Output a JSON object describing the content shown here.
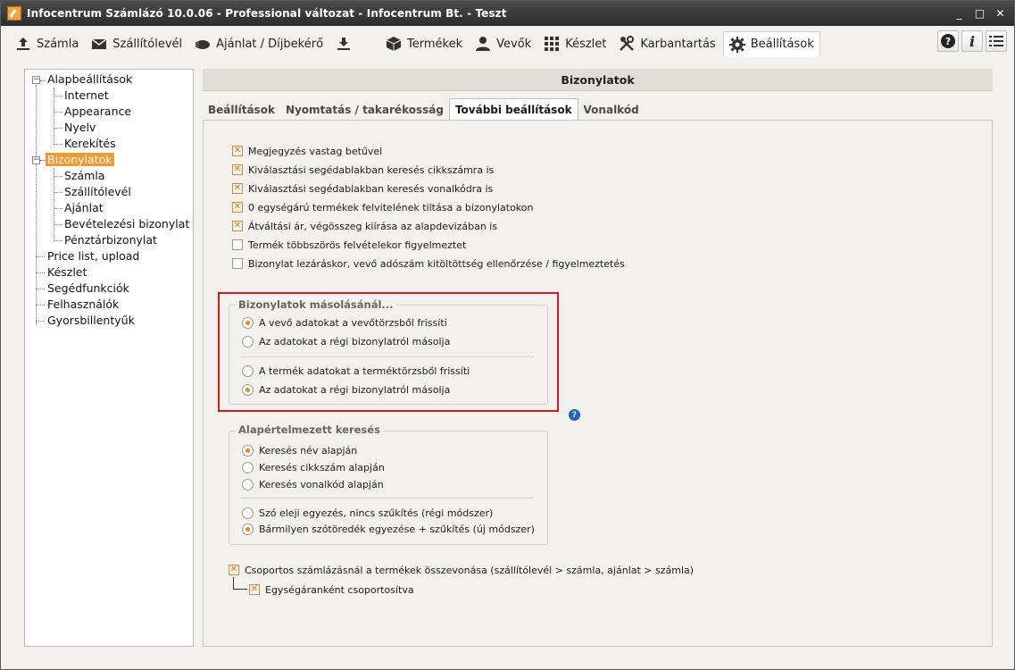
{
  "window": {
    "title": "Infocentrum Számlázó 10.0.06 - Professional változat - Infocentrum Bt. - Teszt",
    "controls": [
      "_",
      "□",
      "✕"
    ]
  },
  "toolbar": {
    "items": [
      {
        "label": "Számla",
        "icon": "upload-icon"
      },
      {
        "label": "Szállítólevél",
        "icon": "envelope-icon"
      },
      {
        "label": "Ajánlat / Díjbekérő",
        "icon": "handshake-icon"
      },
      {
        "label": "",
        "icon": "download-icon"
      },
      {
        "label": "Termékek",
        "icon": "box-icon"
      },
      {
        "label": "Vevők",
        "icon": "person-icon"
      },
      {
        "label": "Készlet",
        "icon": "grid-icon"
      },
      {
        "label": "Karbantartás",
        "icon": "tools-icon"
      },
      {
        "label": "Beállítások",
        "icon": "gear-icon"
      }
    ],
    "right_buttons": [
      "help-icon",
      "info-icon",
      "list-icon"
    ]
  },
  "tree": {
    "root1": "Alapbeállítások",
    "root1_children": [
      "Internet",
      "Appearance",
      "Nyelv",
      "Kerekítés"
    ],
    "root2": "Bizonylatok",
    "root2_children": [
      "Számla",
      "Szállítólevél",
      "Ajánlat",
      "Bevételezési bizonylat",
      "Pénztárbizonylat"
    ],
    "others": [
      "Price list, upload",
      "Készlet",
      "Segédfunkciók",
      "Felhasználók",
      "Gyorsbillentyűk"
    ]
  },
  "panel": {
    "title": "Bizonylatok",
    "tabs": [
      "Beállítások",
      "Nyomtatás / takarékosság",
      "További beállítások",
      "Vonalkód"
    ]
  },
  "checkboxes": [
    {
      "label": "Megjegyzés vastag betűvel",
      "checked": true
    },
    {
      "label": "Kiválasztási segédablakban keresés cikkszámra is",
      "checked": true
    },
    {
      "label": "Kiválasztási segédablakban keresés vonalkódra is",
      "checked": true
    },
    {
      "label": "0 egységárú termékek felvitelének tiltása a bizonylatokon",
      "checked": true
    },
    {
      "label": "Átváltási ár, végösszeg kiírása az alapdevizában is",
      "checked": true
    },
    {
      "label": "Termék többszörös felvételekor figyelmeztet",
      "checked": false
    },
    {
      "label": "Bizonylat lezáráskor, vevő adószám kitöltöttség ellenőrzése / figyelmeztetés",
      "checked": false
    }
  ],
  "copy_group": {
    "title": "Bizonylatok másolásánál...",
    "options_a": [
      {
        "label": "A vevő adatokat a vevőtörzsből frissíti",
        "checked": true
      },
      {
        "label": "Az adatokat a régi bizonylatról másolja",
        "checked": false
      }
    ],
    "options_b": [
      {
        "label": "A termék adatokat a terméktörzsből frissíti",
        "checked": false
      },
      {
        "label": "Az adatokat a régi bizonylatról másolja",
        "checked": true
      }
    ]
  },
  "search_group": {
    "title": "Alapértelmezett keresés",
    "options_a": [
      {
        "label": "Keresés név alapján",
        "checked": true
      },
      {
        "label": "Keresés cikkszám alapján",
        "checked": false
      },
      {
        "label": "Keresés vonalkód alapján",
        "checked": false
      }
    ],
    "options_b": [
      {
        "label": "Szó eleji egyezés, nincs szűkítés (régi módszer)",
        "checked": false
      },
      {
        "label": "Bármilyen szótöredék egyezése + szűkítés (új módszer)",
        "checked": true
      }
    ]
  },
  "bottom": {
    "merge_label": "Csoportos számlázásnál a termékek összevonása (szállítólevél > számla, ajánlat > számla)",
    "merge_checked": true,
    "unit_label": "Egységáranként csoportosítva",
    "unit_checked": true
  },
  "help": "?",
  "colors": {
    "accent": "#f29a31",
    "highlight_box": "#d21d1d",
    "help": "#1e62c9"
  }
}
